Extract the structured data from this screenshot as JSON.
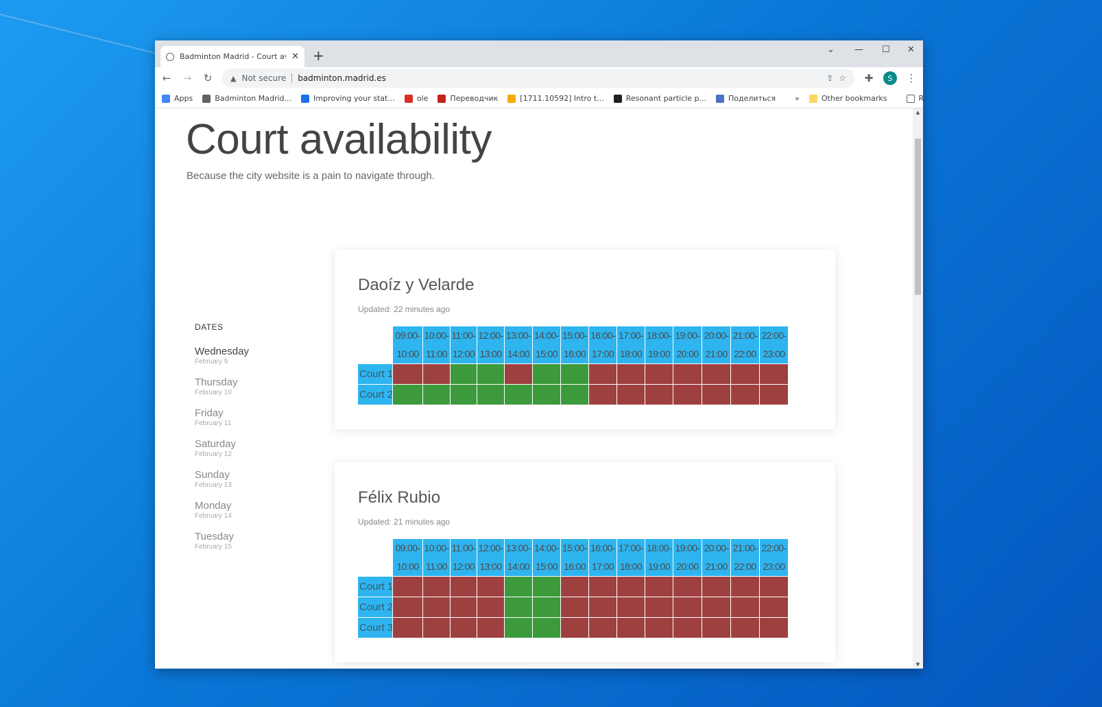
{
  "browser": {
    "tab_title": "Badminton Madrid - Court availa",
    "new_tab": "+",
    "not_secure": "Not secure",
    "url": "badminton.madrid.es",
    "avatar_letter": "S",
    "controls": {
      "chevron": "⌄",
      "minimize": "—",
      "maximize": "☐",
      "close": "✕"
    }
  },
  "bookmarks": {
    "items": [
      {
        "label": "Apps",
        "color": "#4285f4"
      },
      {
        "label": "Badminton Madrid...",
        "color": "#5f6368"
      },
      {
        "label": "Improving your stat...",
        "color": "#1a73e8"
      },
      {
        "label": "ole",
        "color": "#d93025"
      },
      {
        "label": "Переводчик",
        "color": "#c5221f"
      },
      {
        "label": "[1711.10592] Intro t...",
        "color": "#f9ab00"
      },
      {
        "label": "Resonant particle p...",
        "color": "#202124"
      },
      {
        "label": "Поделиться",
        "color": "#4a72c4"
      }
    ],
    "more": "»",
    "other": "Other bookmarks",
    "reading_list": "Reading list"
  },
  "page": {
    "title": "Court availability",
    "subtitle": "Because the city website is a pain to navigate through."
  },
  "dates": {
    "heading": "DATES",
    "items": [
      {
        "day": "Wednesday",
        "date": "February 9",
        "active": true
      },
      {
        "day": "Thursday",
        "date": "February 10",
        "active": false
      },
      {
        "day": "Friday",
        "date": "February 11",
        "active": false
      },
      {
        "day": "Saturday",
        "date": "February 12",
        "active": false
      },
      {
        "day": "Sunday",
        "date": "February 13",
        "active": false
      },
      {
        "day": "Monday",
        "date": "February 14",
        "active": false
      },
      {
        "day": "Tuesday",
        "date": "February 15",
        "active": false
      }
    ]
  },
  "time_slots": [
    "09:00-10:00",
    "10:00-11:00",
    "11:00-12:00",
    "12:00-13:00",
    "13:00-14:00",
    "14:00-15:00",
    "15:00-16:00",
    "16:00-17:00",
    "17:00-18:00",
    "18:00-19:00",
    "19:00-20:00",
    "20:00-21:00",
    "21:00-22:00",
    "22:00-23:00"
  ],
  "venues": [
    {
      "name": "Daoíz y Velarde",
      "updated": "Updated: 22 minutes ago",
      "courts": [
        {
          "label": "Court 1",
          "slots": [
            "booked",
            "booked",
            "free",
            "free",
            "booked",
            "free",
            "free",
            "booked",
            "booked",
            "booked",
            "booked",
            "booked",
            "booked",
            "booked"
          ]
        },
        {
          "label": "Court 2",
          "slots": [
            "free",
            "free",
            "free",
            "free",
            "free",
            "free",
            "free",
            "booked",
            "booked",
            "booked",
            "booked",
            "booked",
            "booked",
            "booked"
          ]
        }
      ]
    },
    {
      "name": "Félix Rubio",
      "updated": "Updated: 21 minutes ago",
      "courts": [
        {
          "label": "Court 1",
          "slots": [
            "booked",
            "booked",
            "booked",
            "booked",
            "free",
            "free",
            "booked",
            "booked",
            "booked",
            "booked",
            "booked",
            "booked",
            "booked",
            "booked"
          ]
        },
        {
          "label": "Court 2",
          "slots": [
            "booked",
            "booked",
            "booked",
            "booked",
            "free",
            "free",
            "booked",
            "booked",
            "booked",
            "booked",
            "booked",
            "booked",
            "booked",
            "booked"
          ]
        },
        {
          "label": "Court 3",
          "slots": [
            "booked",
            "booked",
            "booked",
            "booked",
            "free",
            "free",
            "booked",
            "booked",
            "booked",
            "booked",
            "booked",
            "booked",
            "booked",
            "booked"
          ]
        }
      ]
    }
  ],
  "colors": {
    "header": "#2eb5f0",
    "booked": "#9e4040",
    "free": "#3c9a3c"
  }
}
